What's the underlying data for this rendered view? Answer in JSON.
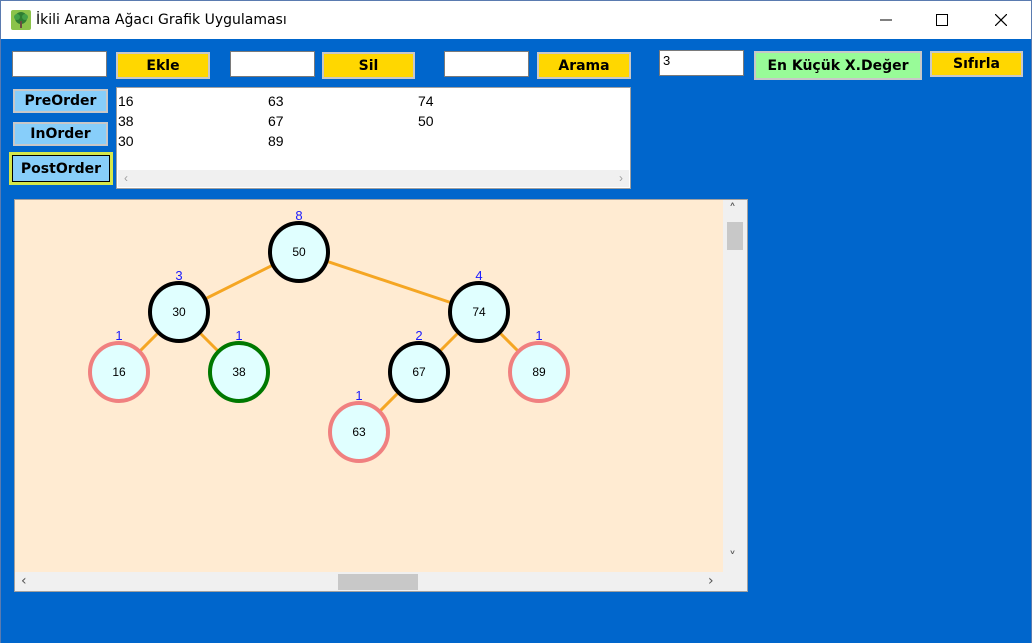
{
  "window": {
    "title": "İkili Arama Ağacı Grafik Uygulaması"
  },
  "controls": {
    "insert_input": "",
    "insert_label": "Ekle",
    "delete_input": "",
    "delete_label": "Sil",
    "search_input": "",
    "search_label": "Arama",
    "kth_input": "3",
    "kth_label": "En Küçük X.Değer",
    "reset_label": "Sıfırla",
    "preorder_label": "PreOrder",
    "inorder_label": "InOrder",
    "postorder_label": "PostOrder"
  },
  "traversal_output": {
    "columns": [
      [
        "16",
        "38",
        "30"
      ],
      [
        "63",
        "67",
        "89"
      ],
      [
        "74",
        "50"
      ]
    ]
  },
  "colors": {
    "background": "#0066CC",
    "canvas": "#FFEBD2",
    "node_fill": "#E0FFFF",
    "node_default_stroke": "#000000",
    "node_leaf_stroke": "#F08080",
    "node_highlight_stroke": "#007800",
    "edge": "#F5A623",
    "count_label": "#1a1aff"
  },
  "tree": {
    "nodes": [
      {
        "id": "50",
        "value": "50",
        "count": "8",
        "type": "internal"
      },
      {
        "id": "30",
        "value": "30",
        "count": "3",
        "type": "internal"
      },
      {
        "id": "74",
        "value": "74",
        "count": "4",
        "type": "internal"
      },
      {
        "id": "16",
        "value": "16",
        "count": "1",
        "type": "leaf"
      },
      {
        "id": "38",
        "value": "38",
        "count": "1",
        "type": "highlight"
      },
      {
        "id": "67",
        "value": "67",
        "count": "2",
        "type": "internal"
      },
      {
        "id": "89",
        "value": "89",
        "count": "1",
        "type": "leaf"
      },
      {
        "id": "63",
        "value": "63",
        "count": "1",
        "type": "leaf"
      }
    ],
    "edges": [
      [
        "50",
        "30"
      ],
      [
        "50",
        "74"
      ],
      [
        "30",
        "16"
      ],
      [
        "30",
        "38"
      ],
      [
        "74",
        "67"
      ],
      [
        "74",
        "89"
      ],
      [
        "67",
        "63"
      ]
    ]
  }
}
